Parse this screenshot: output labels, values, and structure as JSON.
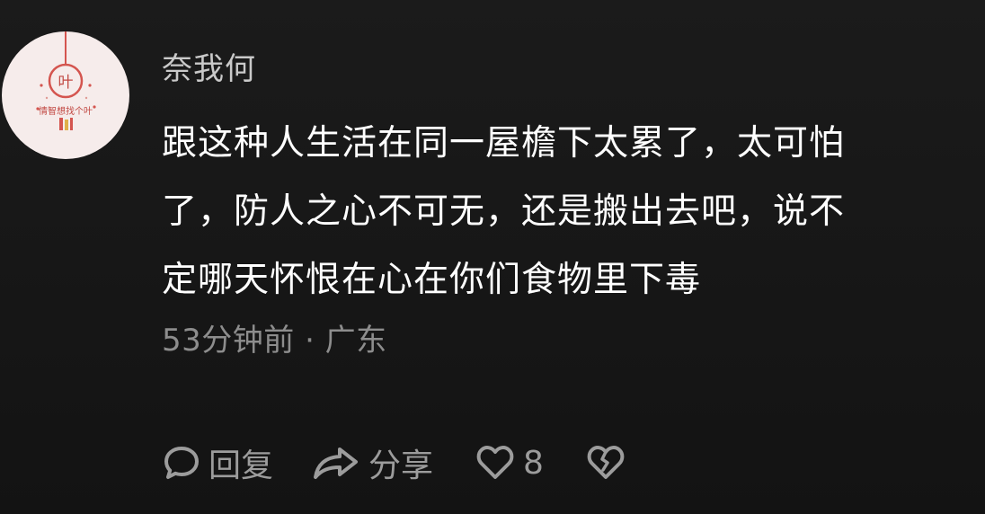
{
  "comment": {
    "avatar": {
      "glyph": "叶",
      "caption": "情智想找个叶",
      "icon": "avatar-lantern-icon"
    },
    "username": "奈我何",
    "body_lines": [
      "跟这种人生活在同一屋檐下太累了，太可怕",
      "了，防人之心不可无，还是搬出去吧，说不",
      "定哪天怀恨在心在你们食物里下毒"
    ],
    "meta": "53分钟前 · 广东",
    "actions": {
      "reply": {
        "icon": "comment-bubble-icon",
        "label": "回复"
      },
      "share": {
        "icon": "share-arrow-icon",
        "label": "分享"
      },
      "like": {
        "icon": "heart-icon",
        "count": "8"
      },
      "dislike": {
        "icon": "broken-heart-icon"
      }
    }
  },
  "colors": {
    "background": "#161616",
    "username": "#c9c9c9",
    "body": "#ffffff",
    "meta": "#8d8d8d",
    "actions": "#9c9c9c",
    "avatar_accent": "#d4554f"
  }
}
